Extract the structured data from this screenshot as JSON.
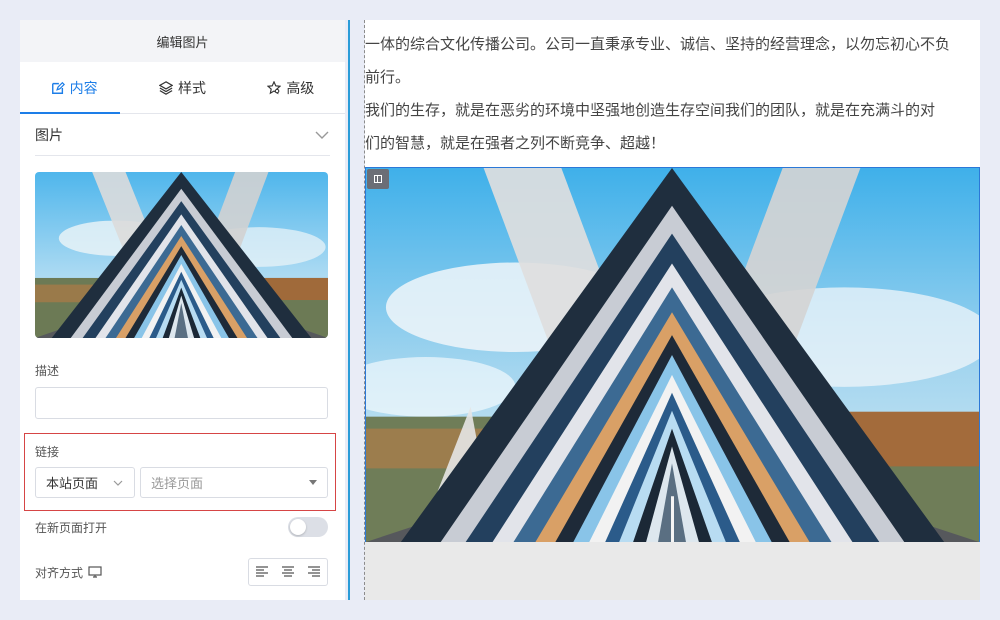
{
  "panel": {
    "title": "编辑图片",
    "tabs": [
      {
        "label": "内容",
        "icon": "edit-icon",
        "active": true
      },
      {
        "label": "样式",
        "icon": "layers-icon",
        "active": false
      },
      {
        "label": "高级",
        "icon": "star-gear-icon",
        "active": false
      }
    ],
    "section_title": "图片",
    "description_label": "描述",
    "description_value": "",
    "link_label": "链接",
    "link_type_value": "本站页面",
    "page_select_placeholder": "选择页面",
    "open_new_label": "在新页面打开",
    "open_new_enabled": false,
    "align_label": "对齐方式",
    "align_options": [
      "align-left-icon",
      "align-center-icon",
      "align-right-icon"
    ]
  },
  "content": {
    "lines": [
      "一体的综合文化传播公司。公司一直秉承专业、诚信、坚持的经营理念，以勿忘初心不负",
      "前行。",
      "我们的生存，就是在恶劣的环境中坚强地创造生存空间我们的团队，就是在充满斗的对",
      "们的智慧，就是在强者之列不断竞争、超越！"
    ]
  },
  "colors": {
    "accent": "#1d7ee8",
    "highlight_border": "#d64545",
    "divider": "#2a9cd8",
    "background": "#e9ecf6"
  }
}
